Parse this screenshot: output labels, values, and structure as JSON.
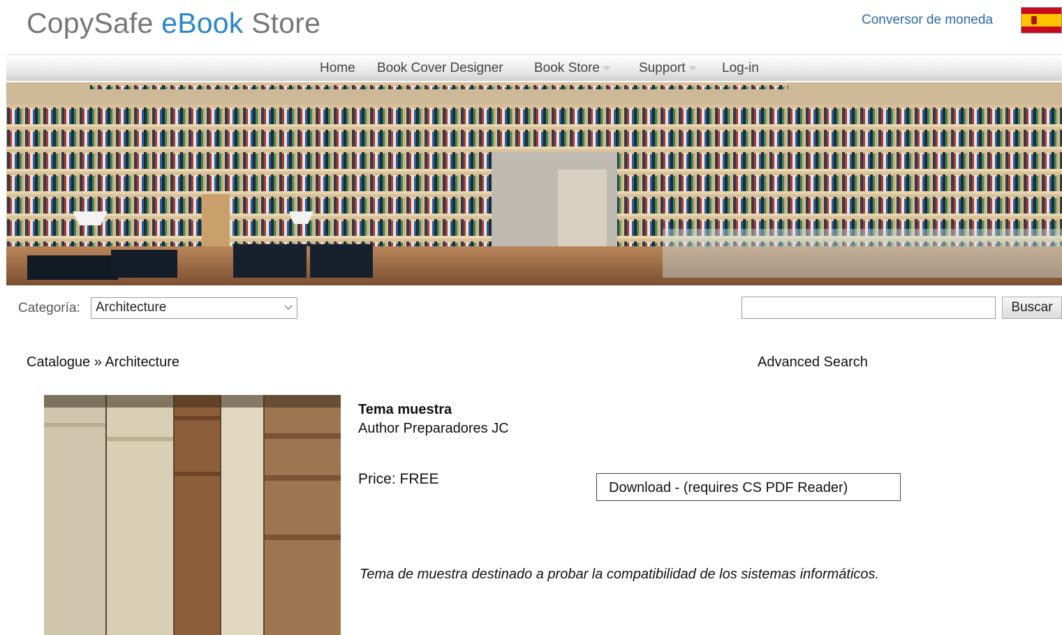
{
  "header": {
    "logo_part1": "CopySafe",
    "logo_part2": "eBook",
    "logo_part3": "Store",
    "currency_link": "Conversor de moneda",
    "flag_icon": "spain-flag-icon"
  },
  "nav": {
    "items": [
      "Home",
      "Book Cover Designer",
      "Book Store",
      "Support",
      "Log-in"
    ]
  },
  "search": {
    "category_label": "Categoría:",
    "category_selected": "Architecture",
    "query_value": "",
    "button_label": "Buscar"
  },
  "content": {
    "breadcrumb": "Catalogue » Architecture",
    "advanced_search": "Advanced Search",
    "book": {
      "title": "Tema muestra",
      "author": "Author Preparadores JC",
      "price": "Price: FREE",
      "download_label": "Download - (requires CS PDF Reader)",
      "description": "Tema de muestra destinado a probar la compatibilidad de los sistemas informáticos."
    }
  },
  "colors": {
    "logo_gray": "#777777",
    "logo_blue": "#2a86c8",
    "link_blue": "#2d6aa6"
  }
}
